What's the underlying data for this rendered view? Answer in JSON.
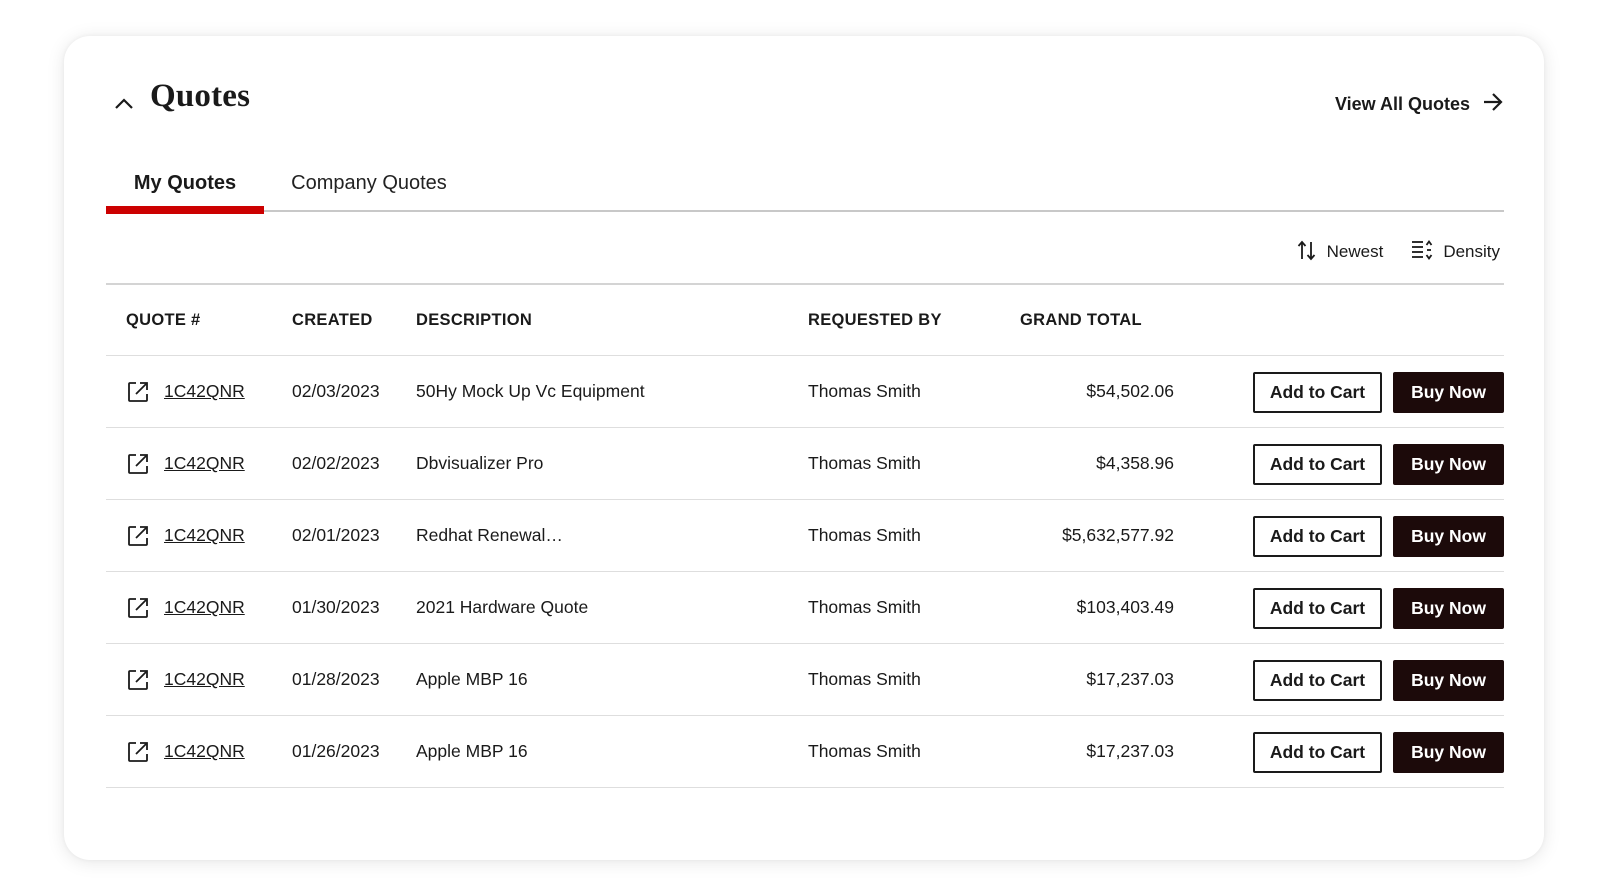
{
  "header": {
    "title": "Quotes",
    "view_all_label": "View All Quotes"
  },
  "tabs": [
    {
      "label": "My Quotes",
      "active": true
    },
    {
      "label": "Company Quotes",
      "active": false
    }
  ],
  "accent_color": "#cc0000",
  "toolbar": {
    "sort_label": "Newest",
    "density_label": "Density"
  },
  "table": {
    "columns": [
      "QUOTE #",
      "CREATED",
      "DESCRIPTION",
      "REQUESTED BY",
      "GRAND TOTAL"
    ],
    "add_to_cart_label": "Add to Cart",
    "buy_now_label": "Buy Now",
    "rows": [
      {
        "quote": "1C42QNR",
        "created": "02/03/2023",
        "description": "50Hy Mock Up Vc Equipment",
        "requested_by": "Thomas Smith",
        "total": "$54,502.06"
      },
      {
        "quote": "1C42QNR",
        "created": "02/02/2023",
        "description": "Dbvisualizer Pro",
        "requested_by": "Thomas Smith",
        "total": "$4,358.96"
      },
      {
        "quote": "1C42QNR",
        "created": "02/01/2023",
        "description": "Redhat Renewal…",
        "requested_by": "Thomas Smith",
        "total": "$5,632,577.92"
      },
      {
        "quote": "1C42QNR",
        "created": "01/30/2023",
        "description": "2021 Hardware Quote",
        "requested_by": "Thomas Smith",
        "total": "$103,403.49"
      },
      {
        "quote": "1C42QNR",
        "created": "01/28/2023",
        "description": "Apple MBP 16",
        "requested_by": "Thomas Smith",
        "total": "$17,237.03"
      },
      {
        "quote": "1C42QNR",
        "created": "01/26/2023",
        "description": "Apple MBP 16",
        "requested_by": "Thomas Smith",
        "total": "$17,237.03"
      }
    ]
  }
}
